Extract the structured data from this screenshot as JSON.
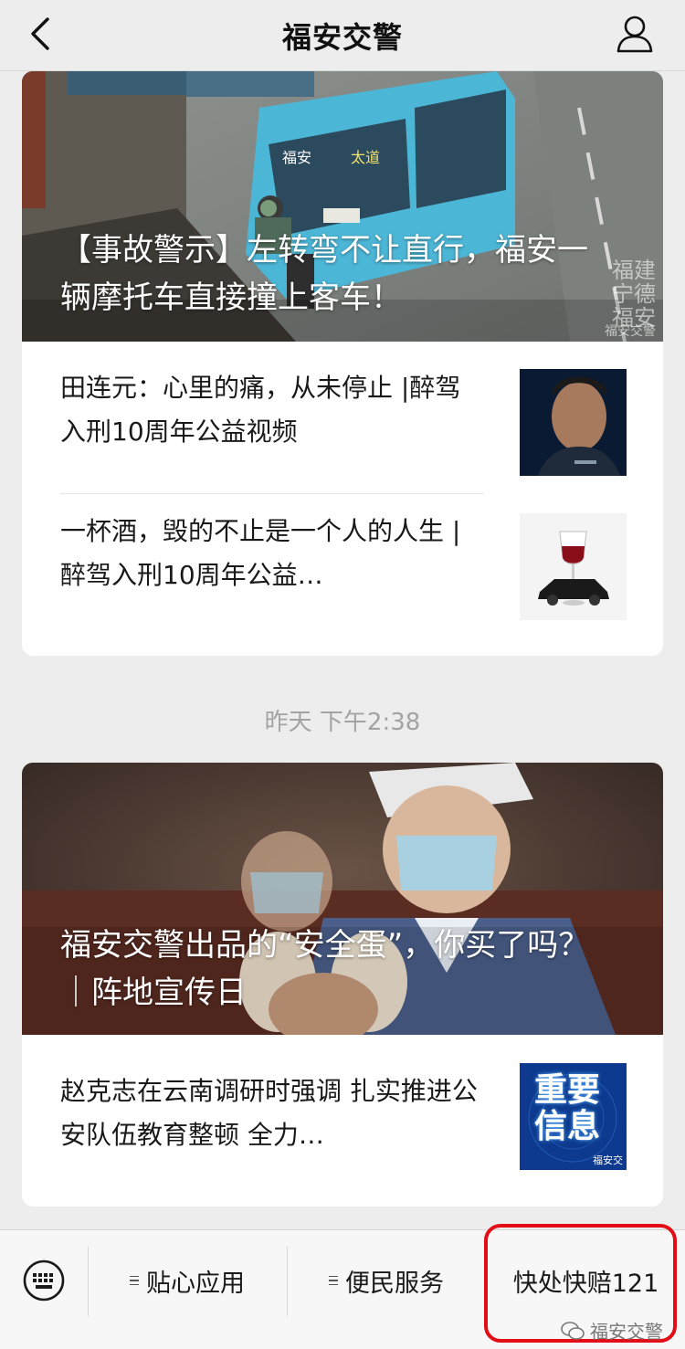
{
  "header": {
    "title": "福安交警"
  },
  "articles_top": {
    "hero_title": "【事故警示】左转弯不让直行，福安一辆摩托车直接撞上客车！",
    "hero_watermark": "福建\n宁德\n福安",
    "hero_watermark_small": "福安交警",
    "bus_labels": {
      "left": "福安",
      "right": "太道"
    },
    "items": [
      {
        "title": "田连元：心里的痛，从未停止 |醉驾入刑10周年公益视频",
        "thumb": "older-man-portrait"
      },
      {
        "title": "一杯酒，毁的不止是一个人的人生 | 醉驾入刑10周年公益…",
        "thumb": "wine-glass-car"
      }
    ]
  },
  "timestamp": "昨天 下午2:38",
  "articles_bottom": {
    "hero_title": "福安交警出品的“安全蛋”，你买了吗？ ｜阵地宣传日",
    "items": [
      {
        "title": "赵克志在云南调研时强调 扎实推进公安队伍教育整顿 全力…",
        "thumb_text": "重要信息",
        "thumb_caption": "福安交"
      }
    ]
  },
  "bottom_menu": {
    "items": [
      "贴心应用",
      "便民服务",
      "快处快赔121"
    ]
  },
  "brand_watermark": "福安交警",
  "colors": {
    "highlight": "#e30d16",
    "background": "#ededed"
  }
}
